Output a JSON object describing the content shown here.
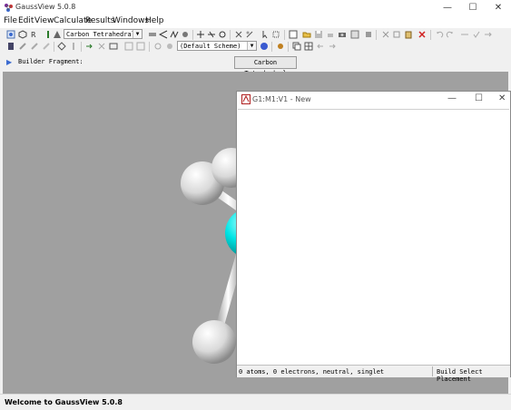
{
  "window": {
    "title": "GaussView 5.0.8"
  },
  "menu": [
    "File",
    "Edit",
    "View",
    "Calculate",
    "Results",
    "Windows",
    "Help"
  ],
  "toolbar": {
    "element_combo": "Carbon Tetrahedral",
    "scheme_combo": "(Default Scheme)"
  },
  "builder": {
    "label": "Builder Fragment:",
    "fragment": "Carbon Tetrahedral"
  },
  "child_window": {
    "title": "G1:M1:V1 - New",
    "status_left": "0 atoms, 0 electrons, neutral, singlet",
    "status_right": "Build Select Placement"
  },
  "status_bar": {
    "message": "Welcome to GaussView 5.0.8"
  },
  "colors": {
    "workspace": "#a0a0a0",
    "atom_carbon": "#00e5e5",
    "atom_hydrogen": "#e8e8e8"
  }
}
